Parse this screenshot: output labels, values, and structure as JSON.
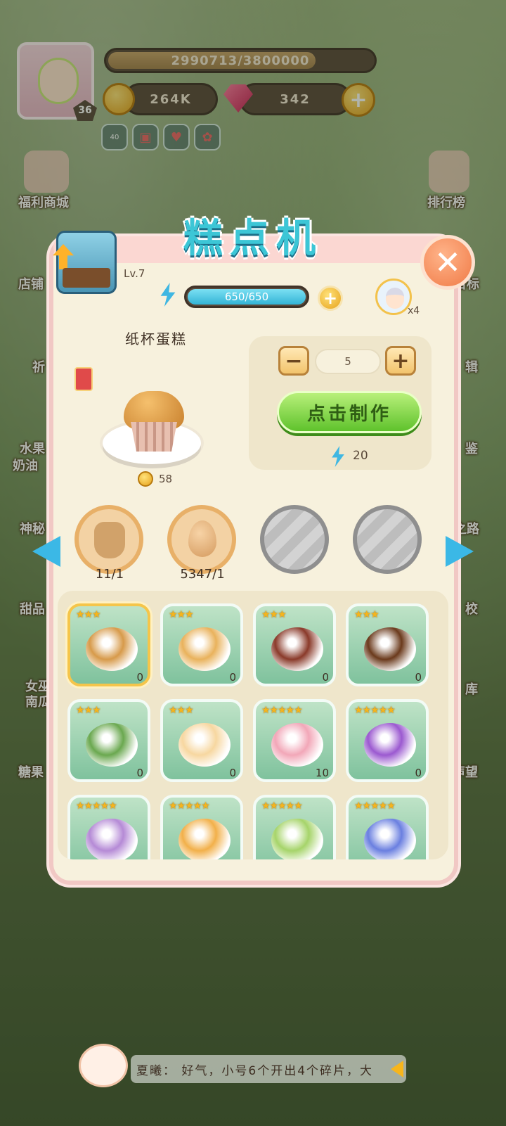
{
  "hud": {
    "xp": "2990713/3800000",
    "xp_fraction": 0.787,
    "player_level": "36",
    "coins": "264K",
    "gems": "342",
    "mini_badge": "40"
  },
  "side_menu": {
    "left": [
      "福利商城",
      "店铺",
      "祈",
      "水果",
      "奶油",
      "神秘",
      "甜品",
      "女巫",
      "南瓜",
      "糖果"
    ],
    "right": [
      "排行榜",
      "目标",
      "辑",
      "鉴",
      "之路",
      "校",
      "库",
      "声望"
    ]
  },
  "panel": {
    "title": "糕点机",
    "level": "Lv.7",
    "energy": "650/650",
    "energy_fraction": 1.0,
    "helper_count": "x4",
    "item_name": "纸杯蛋糕",
    "price": "58",
    "quantity": "5",
    "make_label": "点击制作",
    "cost": "20",
    "ingredients": [
      {
        "name": "flour-sack",
        "count": "11/1"
      },
      {
        "name": "egg",
        "count": "5347/1"
      },
      {
        "name": "empty-slot",
        "count": ""
      },
      {
        "name": "empty-slot",
        "count": ""
      }
    ],
    "recipes": [
      {
        "stars": "★★★",
        "count": "0",
        "color": "#d79a4a"
      },
      {
        "stars": "★★★",
        "count": "0",
        "color": "#e9b25c"
      },
      {
        "stars": "★★★",
        "count": "0",
        "color": "#8a3a2a"
      },
      {
        "stars": "★★★",
        "count": "0",
        "color": "#6b3a1c"
      },
      {
        "stars": "★★★",
        "count": "0",
        "color": "#6aa84f"
      },
      {
        "stars": "★★★",
        "count": "0",
        "color": "#f7d7a0"
      },
      {
        "stars": "★★★★★",
        "count": "10",
        "color": "#f2a7b8"
      },
      {
        "stars": "★★★★★",
        "count": "0",
        "color": "#9b59d0"
      },
      {
        "stars": "★★★★★",
        "count": "",
        "color": "#b58ad6"
      },
      {
        "stars": "★★★★★",
        "count": "",
        "color": "#f2b04a"
      },
      {
        "stars": "★★★★★",
        "count": "",
        "color": "#a6d46a"
      },
      {
        "stars": "★★★★★",
        "count": "",
        "color": "#6a7fe0"
      }
    ]
  },
  "chat": {
    "text": "夏曦：  好气，小号6个开出4个碎片，大"
  }
}
